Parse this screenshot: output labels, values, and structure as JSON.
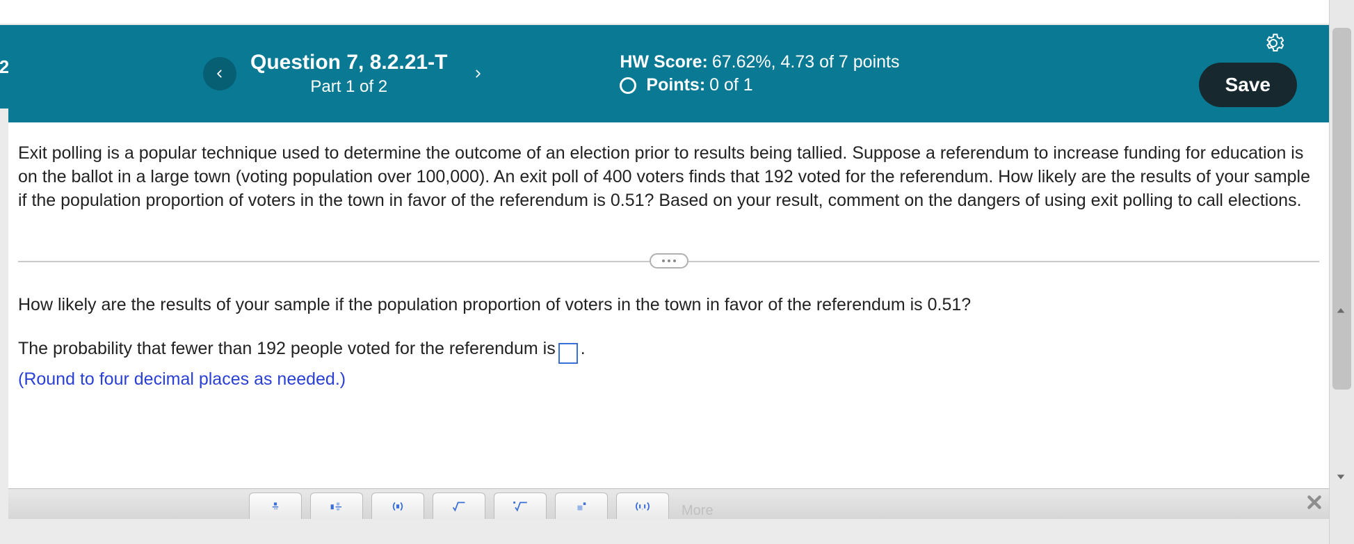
{
  "left_sliver": "2",
  "header": {
    "question_title": "Question 7, 8.2.21-T",
    "part_label": "Part 1 of 2",
    "hw_score_label": "HW Score:",
    "hw_score_value": "67.62%, 4.73 of 7 points",
    "points_label": "Points:",
    "points_value": "0 of 1",
    "save_label": "Save"
  },
  "problem": {
    "text": "Exit polling is a popular technique used to determine the outcome of an election prior to results being tallied. Suppose a referendum to increase funding for education is on the ballot in a large town (voting population over 100,000). An exit poll of 400 voters finds that 192 voted for the referendum. How likely are the results of your sample if the population proportion of voters in the town in favor of the referendum is 0.51? Based on your result, comment on the dangers of using exit polling to call elections."
  },
  "answer": {
    "prompt": "How likely are the results of your sample if the population proportion of voters in the town in favor of the referendum is 0.51?",
    "sentence_before": "The probability that fewer than 192 people voted for the referendum is ",
    "sentence_after": ".",
    "input_value": "",
    "round_note": "(Round to four decimal places as needed.)"
  },
  "footer": {
    "more_label": "More"
  }
}
